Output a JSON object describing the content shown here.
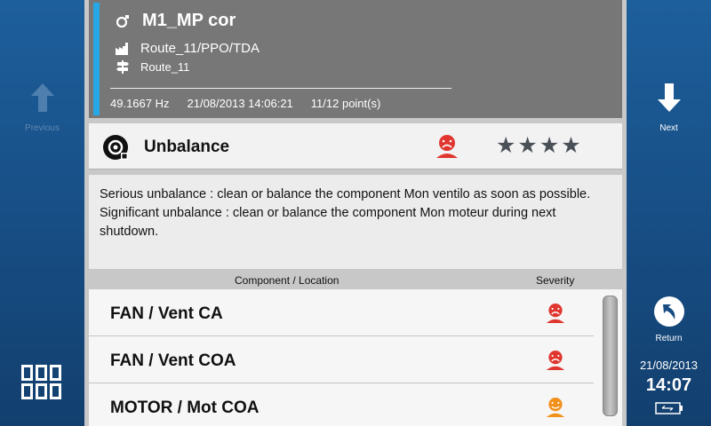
{
  "header": {
    "machine": "M1_MP cor",
    "route": "Route_11/PPO/TDA",
    "sub_route": "Route_11",
    "frequency": "49.1667 Hz",
    "datetime": "21/08/2013 14:06:21",
    "points": "11/12 point(s)"
  },
  "defect": {
    "title": "Unbalance",
    "severity_color": "#e0362f",
    "stars": 4
  },
  "message": {
    "line1": "Serious unbalance : clean or balance the component Mon ventilo as soon as possible.",
    "line2": "Significant unbalance : clean or balance the component Mon moteur during next shutdown."
  },
  "table": {
    "col_component": "Component / Location",
    "col_severity": "Severity",
    "rows": [
      {
        "label": "FAN / Vent CA",
        "severity_color": "#e0362f"
      },
      {
        "label": "FAN / Vent COA",
        "severity_color": "#e0362f"
      },
      {
        "label": "MOTOR / Mot COA",
        "severity_color": "#f2901c"
      }
    ]
  },
  "nav": {
    "previous": "Previous",
    "next": "Next",
    "return": "Return"
  },
  "status": {
    "date": "21/08/2013",
    "time": "14:07"
  },
  "icons": {
    "machine": "machine-icon",
    "route": "factory-icon",
    "sub_route": "signpost-icon",
    "defect": "unbalance-icon",
    "severity": "face-icon",
    "apps": "app-grid-icon",
    "battery": "battery-icon"
  }
}
